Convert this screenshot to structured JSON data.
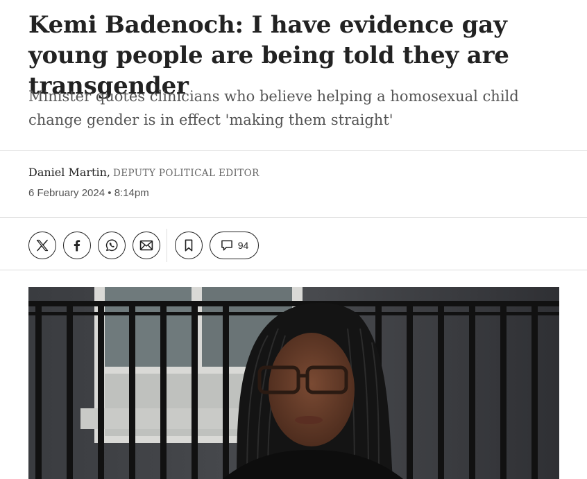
{
  "article": {
    "headline": "Kemi Badenoch: I have evidence gay young people are being told they are transgender",
    "standfirst": "Minister quotes clinicians who believe helping a homosexual child change gender is in effect 'making them straight'",
    "author": "Daniel Martin,",
    "author_role": "DEPUTY POLITICAL EDITOR",
    "date": "6 February 2024",
    "time": "8:14pm"
  },
  "share_bar": {
    "buttons": [
      {
        "icon": "x-twitter-icon"
      },
      {
        "icon": "facebook-icon"
      },
      {
        "icon": "whatsapp-icon"
      },
      {
        "icon": "email-icon"
      }
    ],
    "bookmark_icon": "bookmark-icon",
    "comment_icon": "speech-bubble-icon",
    "comment_count": "94"
  },
  "colors": {
    "text": "#222222",
    "muted": "#555555",
    "rule": "#dcdcdc"
  }
}
